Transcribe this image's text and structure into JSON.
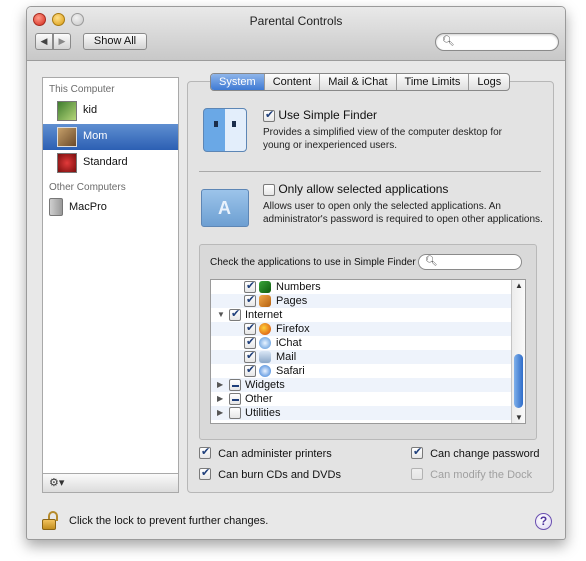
{
  "window": {
    "title": "Parental Controls",
    "show_all": "Show All",
    "nav_back": "◀",
    "nav_forward": "▶",
    "search_placeholder": ""
  },
  "sidebar": {
    "this_computer_label": "This Computer",
    "users": [
      {
        "label": "kid",
        "selected": false,
        "icon": "user-picture-kid"
      },
      {
        "label": "Mom",
        "selected": true,
        "icon": "user-picture-cat"
      },
      {
        "label": "Standard",
        "selected": false,
        "icon": "user-picture-rose"
      }
    ],
    "other_computers_label": "Other Computers",
    "computers": [
      {
        "label": "MacPro",
        "icon": "macpro-icon"
      }
    ],
    "footer_action": "⚙▾"
  },
  "tabs": [
    {
      "label": "System",
      "selected": true
    },
    {
      "label": "Content",
      "selected": false
    },
    {
      "label": "Mail & iChat",
      "selected": false
    },
    {
      "label": "Time Limits",
      "selected": false
    },
    {
      "label": "Logs",
      "selected": false
    }
  ],
  "system": {
    "simple_finder": {
      "label": "Use Simple Finder",
      "checked": true,
      "description_line1": "Provides a simplified view of the computer desktop for",
      "description_line2": "young or inexperienced users."
    },
    "only_selected_apps": {
      "label": "Only allow selected applications",
      "checked": false,
      "description_line1": "Allows user to open only the selected applications. An",
      "description_line2": "administrator's password is required to open other applications."
    },
    "apps_panel": {
      "label": "Check the applications to use in Simple Finder",
      "search_placeholder": "",
      "rows": [
        {
          "label": "Numbers",
          "state": "checked",
          "indent": 1,
          "icon": "numbers-app-icon"
        },
        {
          "label": "Pages",
          "state": "checked",
          "indent": 1,
          "icon": "pages-app-icon"
        },
        {
          "label": "Internet",
          "state": "checked",
          "indent": 0,
          "expanded": true
        },
        {
          "label": "Firefox",
          "state": "checked",
          "indent": 1,
          "icon": "firefox-app-icon"
        },
        {
          "label": "iChat",
          "state": "checked",
          "indent": 1,
          "icon": "ichat-app-icon"
        },
        {
          "label": "Mail",
          "state": "checked",
          "indent": 1,
          "icon": "mail-app-icon"
        },
        {
          "label": "Safari",
          "state": "checked",
          "indent": 1,
          "icon": "safari-app-icon"
        },
        {
          "label": "Widgets",
          "state": "mixed",
          "indent": 0,
          "expanded": false
        },
        {
          "label": "Other",
          "state": "mixed",
          "indent": 0,
          "expanded": false
        },
        {
          "label": "Utilities",
          "state": "unchecked",
          "indent": 0,
          "expanded": false
        }
      ]
    },
    "options": {
      "administer_printers": {
        "label": "Can administer printers",
        "checked": true
      },
      "change_password": {
        "label": "Can change password",
        "checked": true
      },
      "burn_cds": {
        "label": "Can burn CDs and DVDs",
        "checked": true
      },
      "modify_dock": {
        "label": "Can modify the Dock",
        "checked": false,
        "disabled": true
      }
    }
  },
  "footer": {
    "lock_text": "Click the lock to prevent further changes.",
    "help": "?"
  },
  "colors": {
    "selection": "#2c5fb3",
    "tab_selected": "#3f7ad4",
    "window_bg": "#e8e8e8"
  }
}
